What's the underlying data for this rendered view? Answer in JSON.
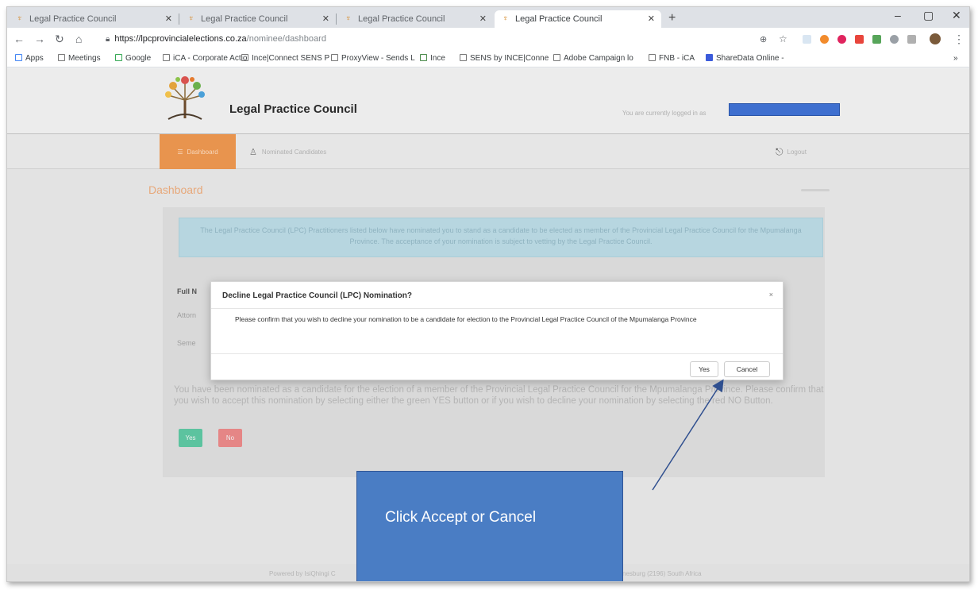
{
  "browser": {
    "tabs": [
      {
        "title": "Legal Practice Council",
        "active": false
      },
      {
        "title": "Legal Practice Council",
        "active": false
      },
      {
        "title": "Legal Practice Council",
        "active": false
      },
      {
        "title": "Legal Practice Council",
        "active": true
      }
    ],
    "new_tab": "+",
    "url_host": "https://lpcprovincialelections.co.za",
    "url_path": "/nominee/dashboard",
    "bookmarks": [
      "Apps",
      "Meetings",
      "Google",
      "iCA - Corporate Actio",
      "Ince|Connect SENS P",
      "ProxyView - Sends L",
      "Ince",
      "SENS by INCE|Conne",
      "Adobe Campaign lo",
      "FNB - iCA",
      "ShareData Online -"
    ]
  },
  "site": {
    "title": "Legal Practice Council",
    "login_text": "You are currently logged in as",
    "nav": {
      "dashboard": "Dashboard",
      "candidates": "Nominated Candidates",
      "logout": "Logout"
    },
    "page_heading": "Dashboard",
    "info_alert": "The Legal Practice Council (LPC) Practitioners listed below have nominated you to stand as a candidate to be elected as member of the Provincial Legal Practice Council for the Mpumalanga Province. The acceptance of your nomination is subject to vetting by the Legal Practice Council.",
    "fields": {
      "fullname_label": "Full N",
      "row2_label": "Attorn",
      "row3_label": "Seme"
    },
    "accept_instructions": "You have been nominated as a candidate for the election of a member of the Provincial Legal Practice Council for the Mpumalanga Province. Please confirm that you wish to accept this nomination by selecting either the green YES button or if you wish to decline your nomination by selecting the red NO Button.",
    "yes_label": "Yes",
    "no_label": "No",
    "footer_left": "Powered by IsiQhingi C",
    "footer_right": "nesburg (2196) South Africa"
  },
  "modal": {
    "title": "Decline Legal Practice Council (LPC) Nomination?",
    "close": "×",
    "body": "Please confirm that you wish to decline your nomination to be a candidate for election to the Provincial Legal Practice Council of the Mpumalanga Province",
    "yes_label": "Yes",
    "cancel_label": "Cancel"
  },
  "annotation": {
    "text": "Click Accept or Cancel"
  },
  "colors": {
    "nav_active": "#e8944e",
    "info_alert_bg": "#b7d6e0",
    "yes_button": "#5cc39f",
    "no_button": "#e58686",
    "callout": "#4a7dc4",
    "redaction": "#3e6fcf"
  }
}
